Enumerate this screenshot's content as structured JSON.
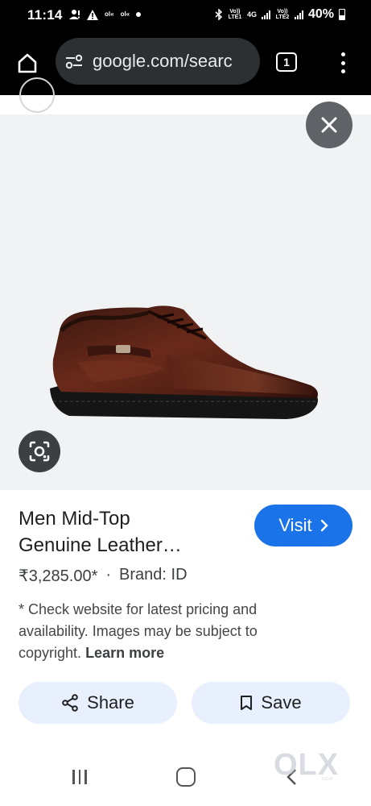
{
  "status_bar": {
    "time": "11:14",
    "battery": "40%",
    "icons": [
      "person-alert-icon",
      "warning-icon",
      "signal-indicator-icon",
      "signal-indicator-icon",
      "dot-icon",
      "bluetooth-icon",
      "volte-lte1-icon",
      "4g-icon",
      "signal-bars-icon",
      "volte-lte2-icon",
      "signal-bars-icon",
      "battery-icon"
    ],
    "lte1_label": "Vo)) LTE1",
    "lte2_label": "Vo)) LTE2",
    "net_label": "4G"
  },
  "toolbar": {
    "url": "google.com/searc",
    "tab_count": "1",
    "icons": [
      "home-icon",
      "site-settings-icon",
      "tabs-icon",
      "more-menu-icon"
    ]
  },
  "image_viewer": {
    "icons": [
      "close-icon",
      "google-lens-icon"
    ],
    "image_subject": "brown leather mid-top men's shoe"
  },
  "product": {
    "title_line1": "Men Mid-Top",
    "title_line2": "Genuine Leather…",
    "visit_label": "Visit",
    "price": "₹3,285.00*",
    "separator": "·",
    "brand": "Brand: ID",
    "disclaimer": "* Check website for latest pricing and availability. Images may be subject to copyright.",
    "learn_more": "Learn more"
  },
  "actions": {
    "share_label": "Share",
    "save_label": "Save",
    "icons": [
      "share-icon",
      "bookmark-icon"
    ]
  },
  "nav_bar": {
    "icons": [
      "recent-apps-icon",
      "home-button-icon",
      "back-icon"
    ]
  },
  "watermark": {
    "text": "OLX",
    "sub": "INDIA"
  },
  "colors": {
    "visit_button": "#1a73e8",
    "action_buttons": "#e8f0fe",
    "toolbar": "#000000",
    "url_pill": "#2d3033",
    "image_bg": "#f1f2f4"
  }
}
